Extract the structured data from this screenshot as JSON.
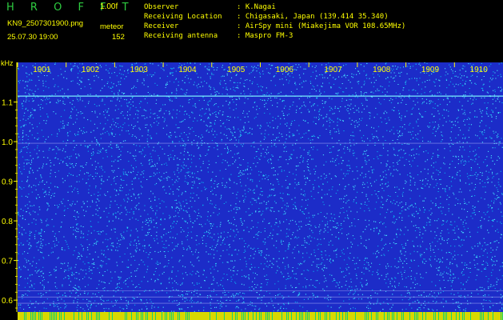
{
  "header": {
    "brand": "H R O F F T",
    "version": "1.00f",
    "filename": "KN9_2507301900.png",
    "meteor_label": "meteor",
    "datetime": "25.07.30 19:00",
    "meteor_count": "152"
  },
  "station_info": [
    {
      "label": "Observer",
      "value": ": K.Nagai"
    },
    {
      "label": "Receiving Location",
      "value": ": Chigasaki, Japan (139.414 35.340)"
    },
    {
      "label": "Receiver",
      "value": ": AirSpy mini (Miakejima VOR 108.65MHz)"
    },
    {
      "label": "Receiving antenna",
      "value": ": Maspro FM-3"
    }
  ],
  "spectrogram": {
    "y_unit": "kHz",
    "time_labels": [
      "1901",
      "1902",
      "1903",
      "1904",
      "1905",
      "1906",
      "1907",
      "1908",
      "1909",
      "1910"
    ],
    "freq_ticks": [
      "1.1",
      "1.0",
      "0.9",
      "0.8",
      "0.7",
      "0.6"
    ],
    "freq_values": [
      1.1,
      1.0,
      0.9,
      0.8,
      0.7,
      0.6
    ],
    "freq_range": [
      0.57,
      1.2
    ],
    "background_color": "#1c2cc8",
    "noise_colors": [
      "#00e5ff",
      "#2fd2ff",
      "#12a0ff",
      "#6fe8ff",
      "#00b8e8"
    ],
    "carrier_lines_khz": [
      1.115,
      0.996,
      0.623,
      0.608,
      0.592
    ],
    "axis_color": "#ffff00",
    "grid_color": "#ffffff"
  }
}
